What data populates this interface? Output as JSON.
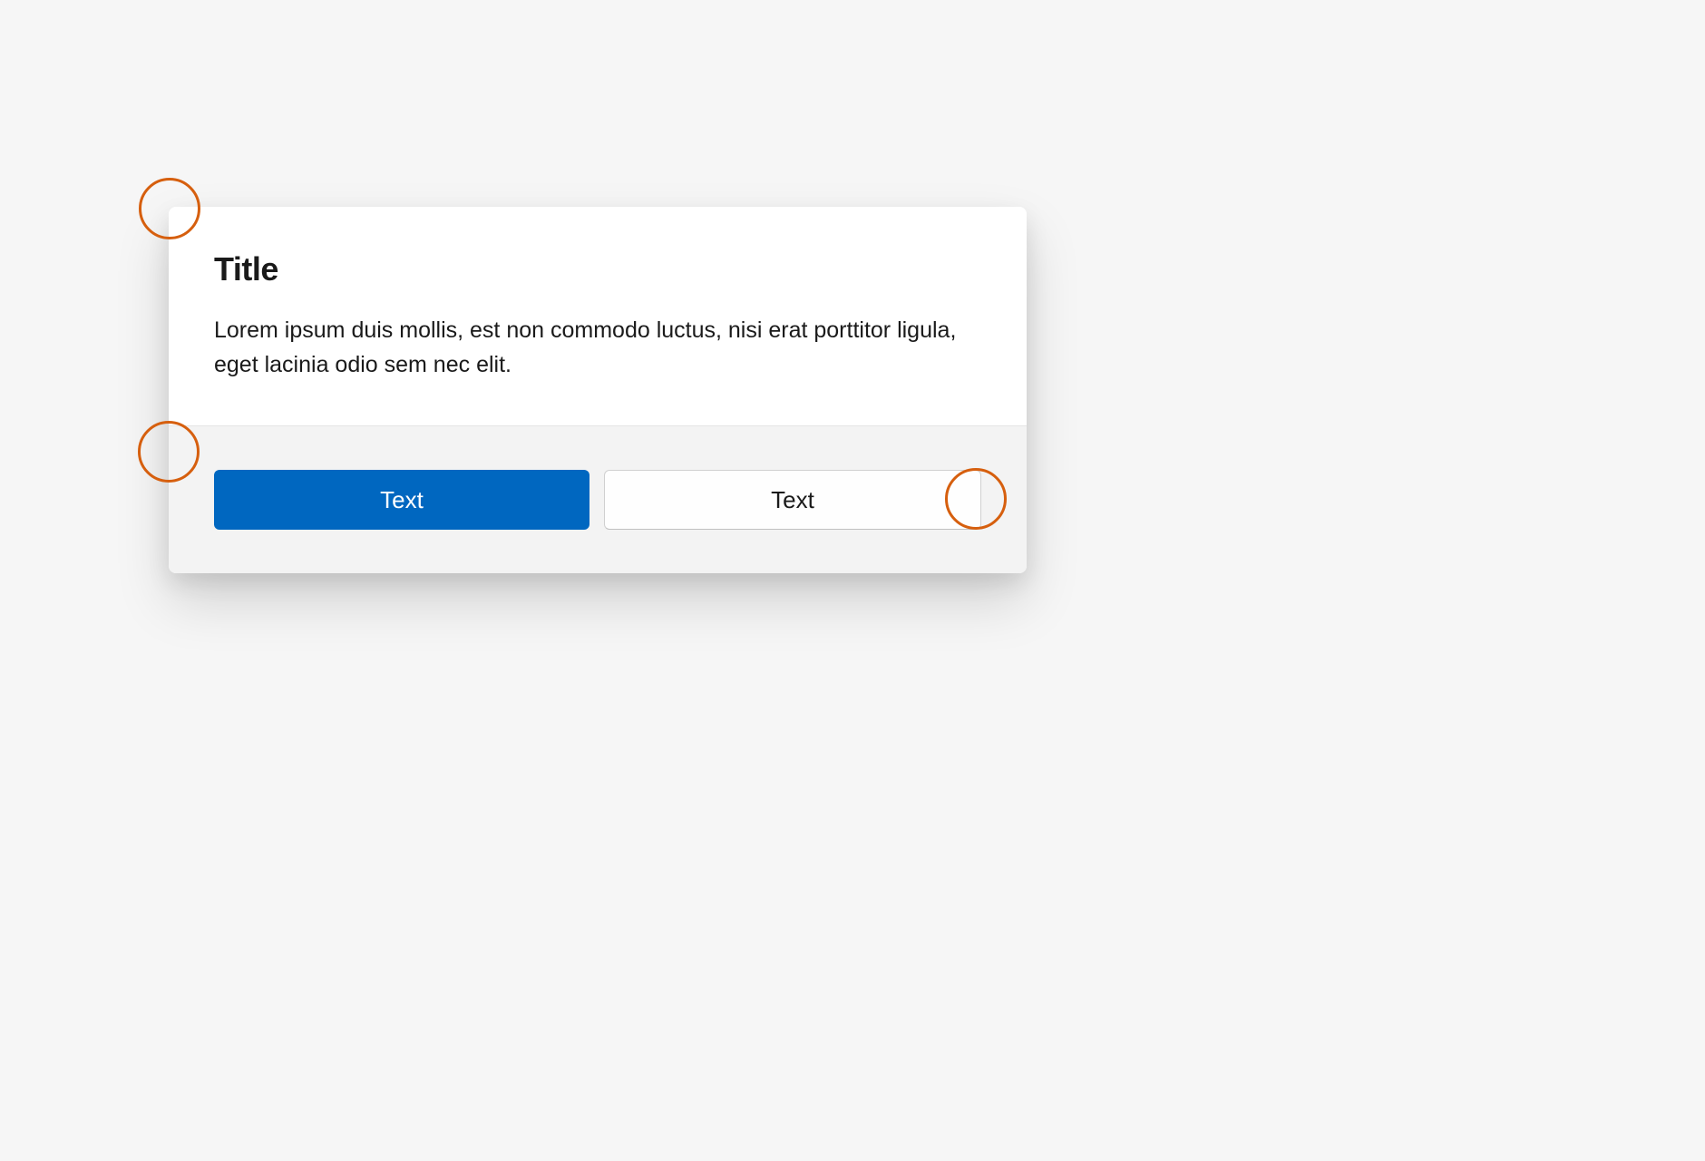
{
  "dialog": {
    "title": "Title",
    "body": "Lorem ipsum duis mollis, est non commodo luctus, nisi erat porttitor ligula, eget lacinia odio sem nec elit.",
    "primary_button": "Text",
    "secondary_button": "Text"
  },
  "colors": {
    "primary": "#0067c0",
    "annotation": "#d65f0e"
  }
}
